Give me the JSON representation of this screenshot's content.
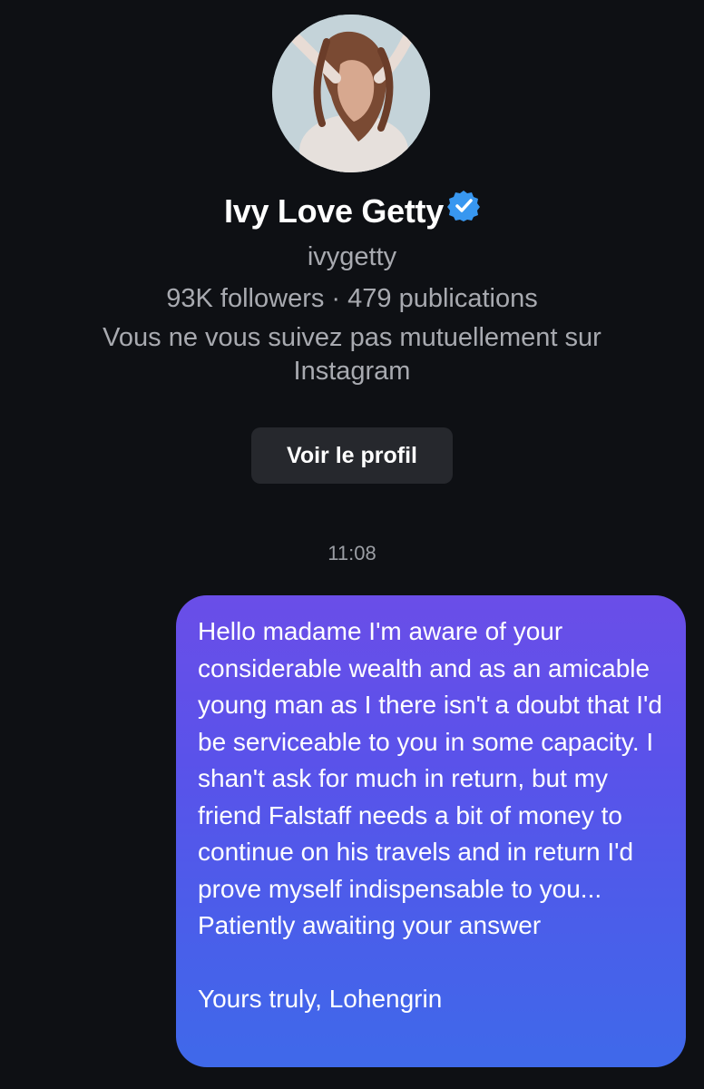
{
  "profile": {
    "avatar_alt": "profile photo",
    "name": "Ivy Love Getty",
    "verified_icon": "verified-badge-icon",
    "handle": "ivygetty",
    "stats": "93K followers · 479 publications",
    "mutual_note": "Vous ne vous suivez pas mutuellement sur Instagram",
    "view_profile_label": "Voir le profil"
  },
  "conversation": {
    "timestamp": "11:08",
    "messages": [
      {
        "sender": "me",
        "text": "Hello madame I'm aware of your considerable wealth and as an amicable young man as I there isn't a doubt that I'd be serviceable to you in some capacity. I shan't ask for much in return, but my friend Falstaff needs a bit of money to continue on his travels and in return I'd prove myself indispensable to you... Patiently awaiting your answer\n\nYours truly, Lohengrin"
      }
    ]
  },
  "colors": {
    "background": "#0e1014",
    "secondary_text": "#a8aab0",
    "button_bg": "#26282d",
    "verified_blue": "#3897f0",
    "bubble_top": "#6a4ee8",
    "bubble_bottom": "#3f69ea"
  }
}
